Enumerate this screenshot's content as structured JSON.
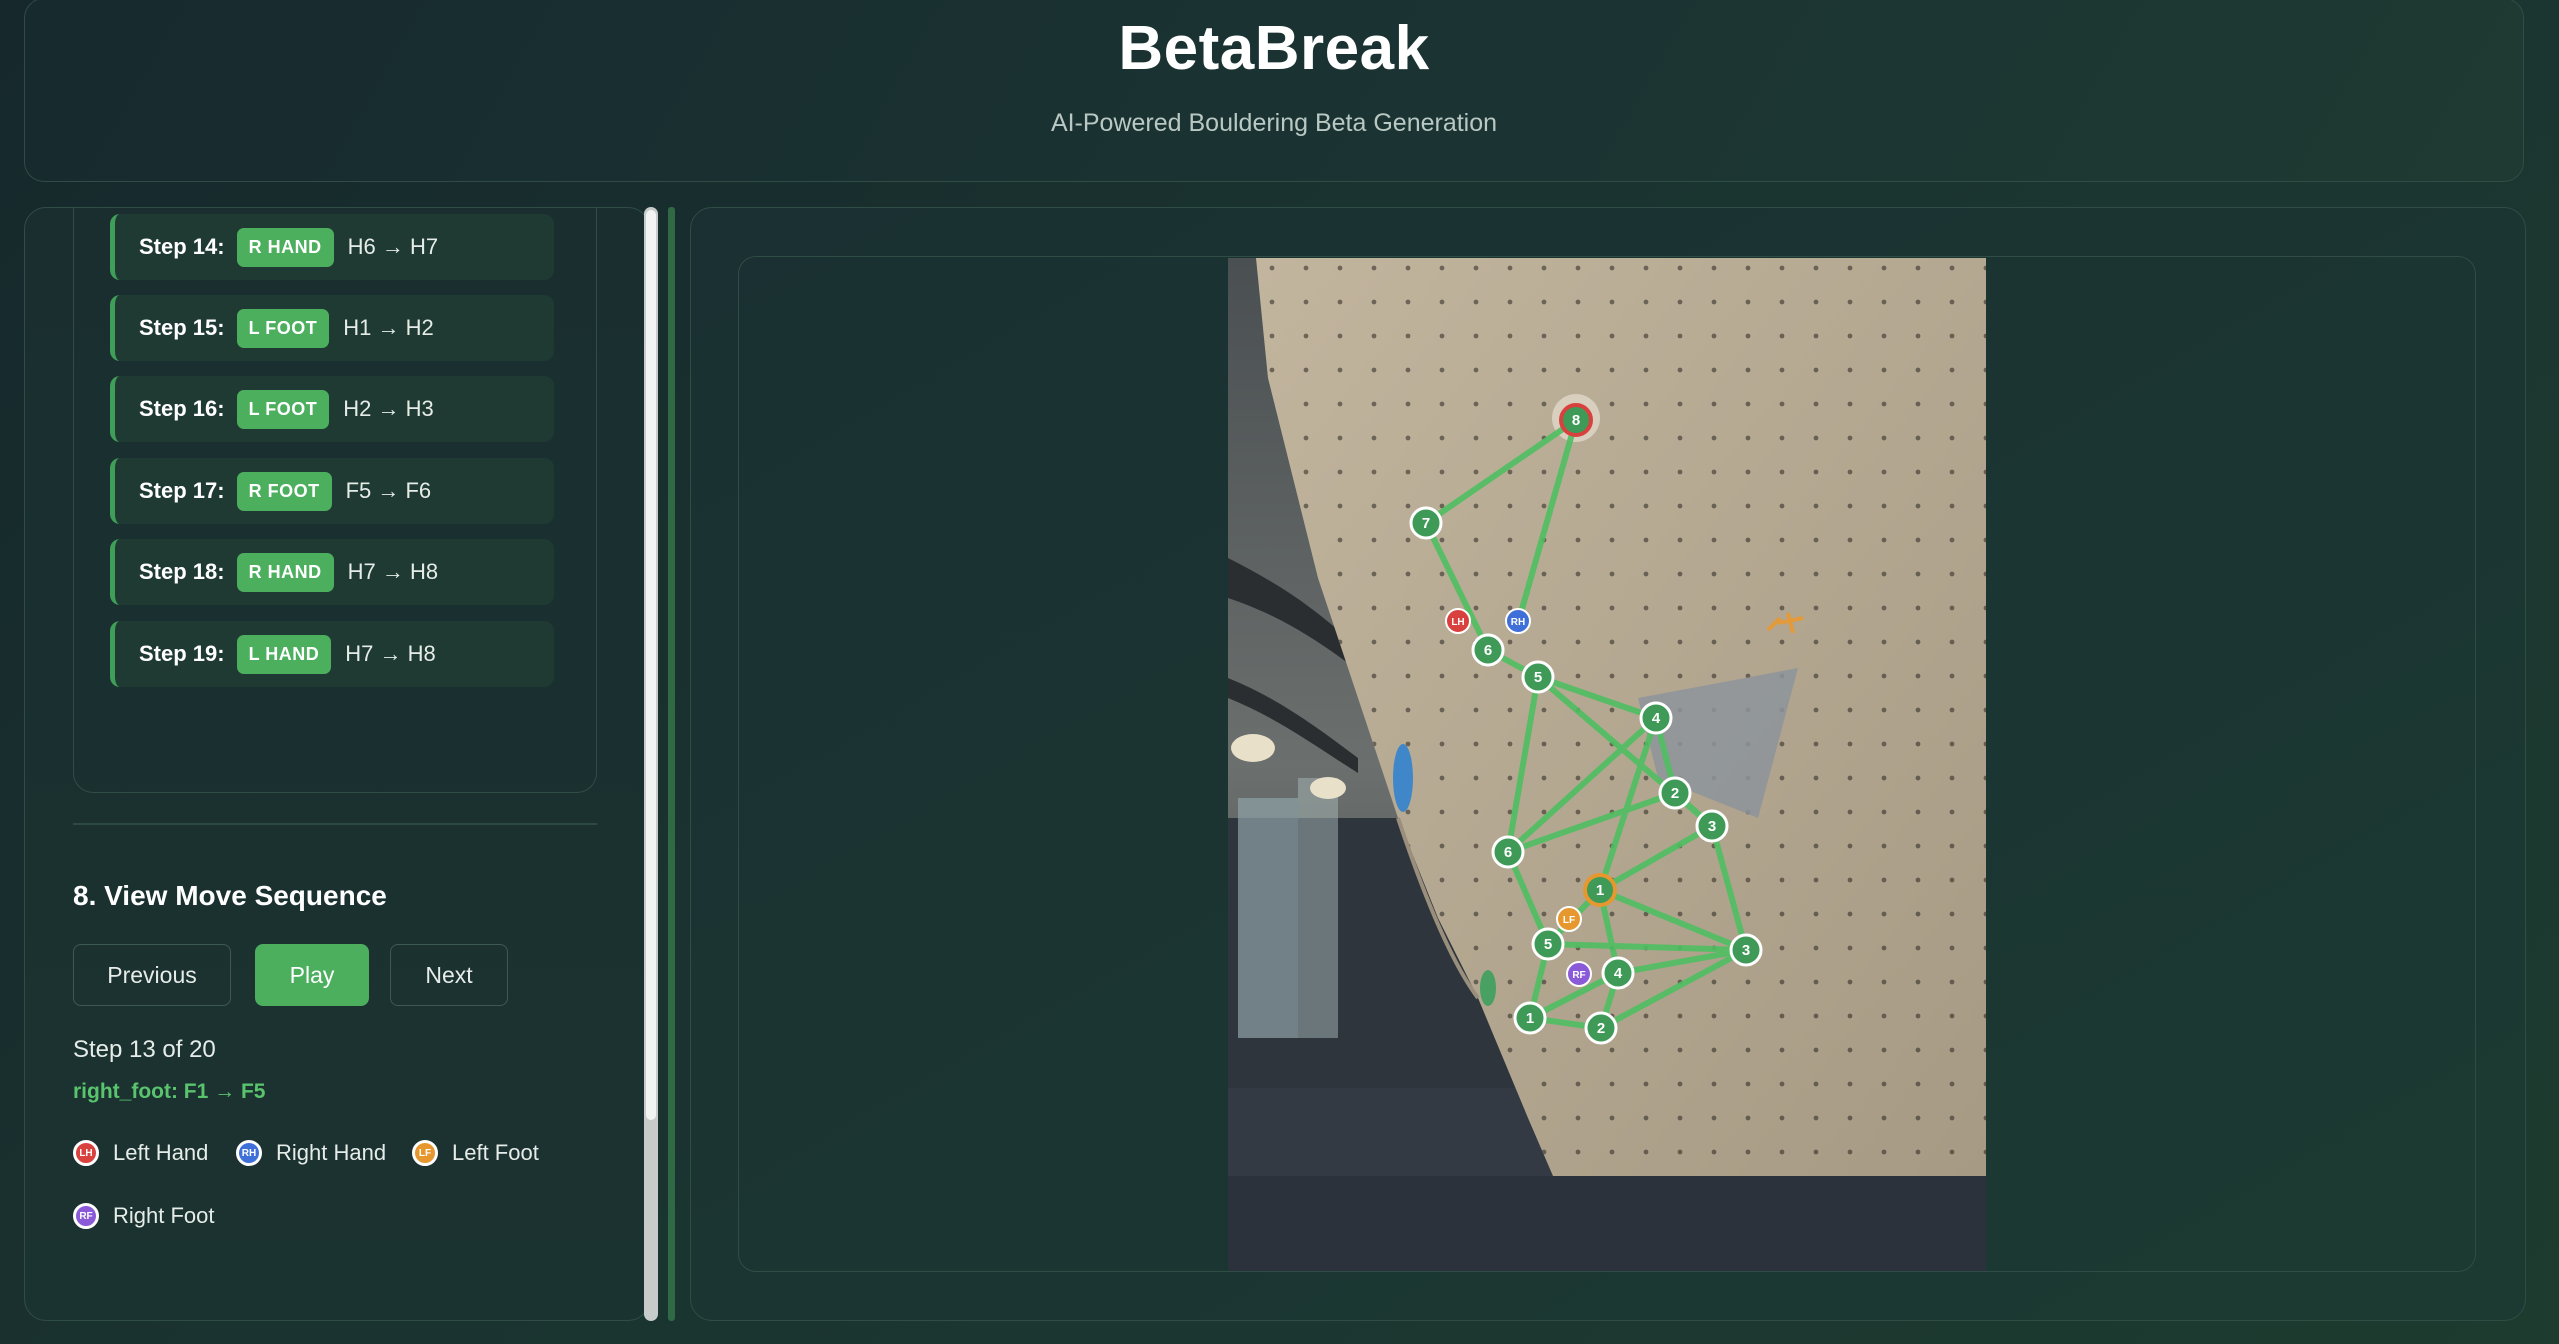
{
  "header": {
    "title": "BetaBreak",
    "subtitle": "AI-Powered Bouldering Beta Generation"
  },
  "steps": [
    {
      "label": "Step 14:",
      "limb": "R HAND",
      "move": "H6 → H7"
    },
    {
      "label": "Step 15:",
      "limb": "L FOOT",
      "move": "H1 → H2"
    },
    {
      "label": "Step 16:",
      "limb": "L FOOT",
      "move": "H2 → H3"
    },
    {
      "label": "Step 17:",
      "limb": "R FOOT",
      "move": "F5 → F6"
    },
    {
      "label": "Step 18:",
      "limb": "R HAND",
      "move": "H7 → H8"
    },
    {
      "label": "Step 19:",
      "limb": "L HAND",
      "move": "H7 → H8"
    }
  ],
  "sequence": {
    "title": "8. View Move Sequence",
    "prev_label": "Previous",
    "play_label": "Play",
    "next_label": "Next",
    "step_count": "Step 13 of 20",
    "current_move": "right_foot: F1 → F5"
  },
  "legend": [
    {
      "abbr": "LH",
      "label": "Left Hand",
      "color": "#d9413f"
    },
    {
      "abbr": "RH",
      "label": "Right Hand",
      "color": "#3f6fd9"
    },
    {
      "abbr": "LF",
      "label": "Left Foot",
      "color": "#e6982e"
    },
    {
      "abbr": "RF",
      "label": "Right Foot",
      "color": "#8a5ad9"
    }
  ],
  "overlay": {
    "hand_holds": [
      "1",
      "2",
      "3",
      "4",
      "5",
      "6",
      "7",
      "8"
    ],
    "foot_holds": [
      "1",
      "2",
      "3",
      "4",
      "5",
      "6"
    ],
    "limb_markers": [
      "LH",
      "RH",
      "LF",
      "RF"
    ],
    "line_color": "#4fbf62"
  }
}
